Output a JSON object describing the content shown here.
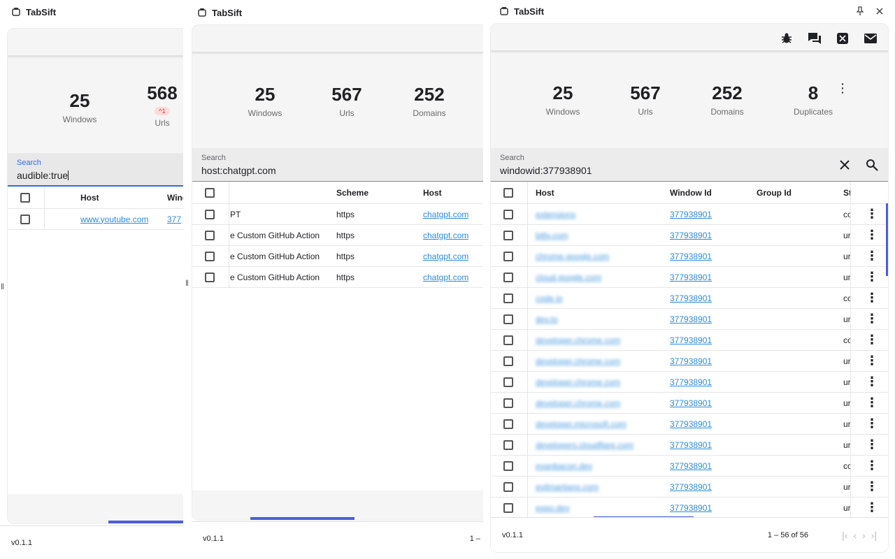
{
  "app_title": "TabSift",
  "version": "v0.1.1",
  "panel1": {
    "stats": [
      {
        "num": "25",
        "label": "Windows"
      },
      {
        "num": "568",
        "label": "Urls",
        "badge": "^1"
      }
    ],
    "search": {
      "label": "Search",
      "value": "audible:true"
    },
    "columns": [
      "Host",
      "Wind"
    ],
    "rows": [
      {
        "host": "www.youtube.com",
        "window": "377"
      }
    ]
  },
  "panel2": {
    "stats": [
      {
        "num": "25",
        "label": "Windows"
      },
      {
        "num": "567",
        "label": "Urls"
      },
      {
        "num": "252",
        "label": "Domains"
      }
    ],
    "search": {
      "label": "Search",
      "value": "host:chatgpt.com"
    },
    "columns": [
      "Scheme",
      "Host"
    ],
    "rows": [
      {
        "title": "PT",
        "scheme": "https",
        "host": "chatgpt.com"
      },
      {
        "title": "e Custom GitHub Action",
        "scheme": "https",
        "host": "chatgpt.com"
      },
      {
        "title": "e Custom GitHub Action",
        "scheme": "https",
        "host": "chatgpt.com"
      },
      {
        "title": "e Custom GitHub Action",
        "scheme": "https",
        "host": "chatgpt.com"
      }
    ],
    "pagination": "1 –"
  },
  "panel3": {
    "stats": [
      {
        "num": "25",
        "label": "Windows"
      },
      {
        "num": "567",
        "label": "Urls"
      },
      {
        "num": "252",
        "label": "Domains"
      },
      {
        "num": "8",
        "label": "Duplicates"
      }
    ],
    "search": {
      "label": "Search",
      "value": "windowid:377938901"
    },
    "columns": [
      "Host",
      "Window Id",
      "Group Id",
      "St"
    ],
    "rows": [
      {
        "host": "extensions",
        "window": "377938901",
        "st": "cc"
      },
      {
        "host": "bitly.com",
        "window": "377938901",
        "st": "ur"
      },
      {
        "host": "chrome.google.com",
        "window": "377938901",
        "st": "ur"
      },
      {
        "host": "cloud.google.com",
        "window": "377938901",
        "st": "ur"
      },
      {
        "host": "code.io",
        "window": "377938901",
        "st": "cc"
      },
      {
        "host": "dev.to",
        "window": "377938901",
        "st": "ur"
      },
      {
        "host": "developer.chrome.com",
        "window": "377938901",
        "st": "cc"
      },
      {
        "host": "developer.chrome.com",
        "window": "377938901",
        "st": "ur"
      },
      {
        "host": "developer.chrome.com",
        "window": "377938901",
        "st": "ur"
      },
      {
        "host": "developer.chrome.com",
        "window": "377938901",
        "st": "ur"
      },
      {
        "host": "developer.microsoft.com",
        "window": "377938901",
        "st": "ur"
      },
      {
        "host": "developers.cloudflare.com",
        "window": "377938901",
        "st": "ur"
      },
      {
        "host": "evanbacon.dev",
        "window": "377938901",
        "st": "cc"
      },
      {
        "host": "evilmartians.com",
        "window": "377938901",
        "st": "ur"
      },
      {
        "host": "expo.dev",
        "window": "377938901",
        "st": "ur"
      }
    ],
    "pagination": "1 – 56 of 56"
  },
  "icons": {
    "toolbar": [
      "bug-icon",
      "chat-icon",
      "x-logo-icon",
      "mail-icon"
    ],
    "window": [
      "pin-icon",
      "close-icon"
    ],
    "search": [
      "clear-icon",
      "search-icon"
    ],
    "pager": [
      "first-page-icon",
      "prev-page-icon",
      "next-page-icon",
      "last-page-icon"
    ]
  },
  "colors": {
    "accent": "#4c5fd5",
    "link": "#2f8bd6",
    "badge_bg": "#fcdcdc",
    "badge_text": "#dd3333"
  }
}
